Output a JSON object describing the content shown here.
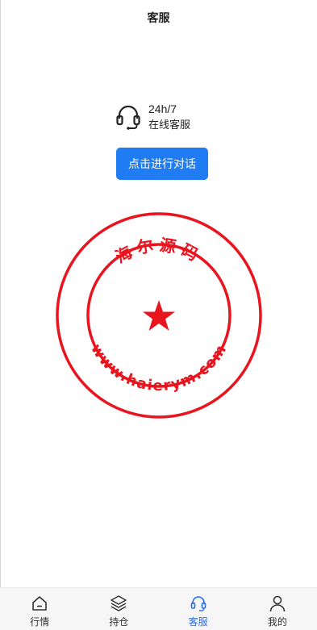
{
  "header": {
    "title": "客服"
  },
  "service": {
    "icon": "headset-icon",
    "hours": "24h/7",
    "label": "在线客服"
  },
  "chat_button": {
    "label": "点击进行对话",
    "color": "#1f7cf3"
  },
  "seal": {
    "top_text": "海尔源码",
    "bottom_text": "www.haierym.com",
    "color": "#e8141e"
  },
  "tabbar": {
    "active_color": "#2a6fe8",
    "items": [
      {
        "label": "行情",
        "icon": "home-icon"
      },
      {
        "label": "持仓",
        "icon": "layers-icon"
      },
      {
        "label": "客服",
        "icon": "headset-icon"
      },
      {
        "label": "我的",
        "icon": "user-icon"
      }
    ]
  }
}
